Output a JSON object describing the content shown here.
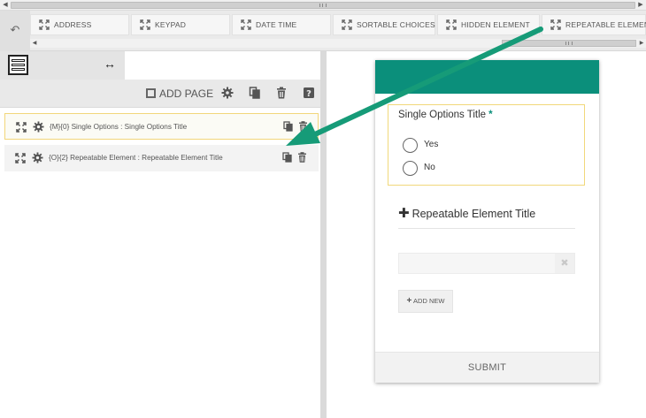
{
  "colors": {
    "accent": "#0b8f7b",
    "selected_border": "#f1d87a",
    "arrow": "#169b78"
  },
  "toolbox": {
    "back_icon": "undo-icon",
    "items": [
      {
        "label": "ADDRESS",
        "icon": "move-icon"
      },
      {
        "label": "KEYPAD",
        "icon": "move-icon"
      },
      {
        "label": "DATE TIME",
        "icon": "move-icon"
      },
      {
        "label": "SORTABLE CHOICES",
        "icon": "move-icon"
      },
      {
        "label": "HIDDEN ELEMENT",
        "icon": "move-icon"
      },
      {
        "label": "REPEATABLE ELEMENT",
        "icon": "move-icon"
      }
    ]
  },
  "left_panel": {
    "expand_symbol": "↔",
    "add_page_label": "ADD PAGE",
    "elements": [
      {
        "label": "{M}{0} Single Options : Single Options Title",
        "selected": true
      },
      {
        "label": "{O}{2} Repeatable Element : Repeatable Element Title",
        "selected": false
      }
    ]
  },
  "form": {
    "question_title": "Single Options Title",
    "required_mark": "*",
    "options": [
      "Yes",
      "No"
    ],
    "repeatable_plus": "✚",
    "repeatable_title": "Repeatable Element Title",
    "clear_symbol": "✖",
    "add_new_plus": "+",
    "add_new_label": "ADD NEW",
    "submit_label": "SUBMIT"
  }
}
